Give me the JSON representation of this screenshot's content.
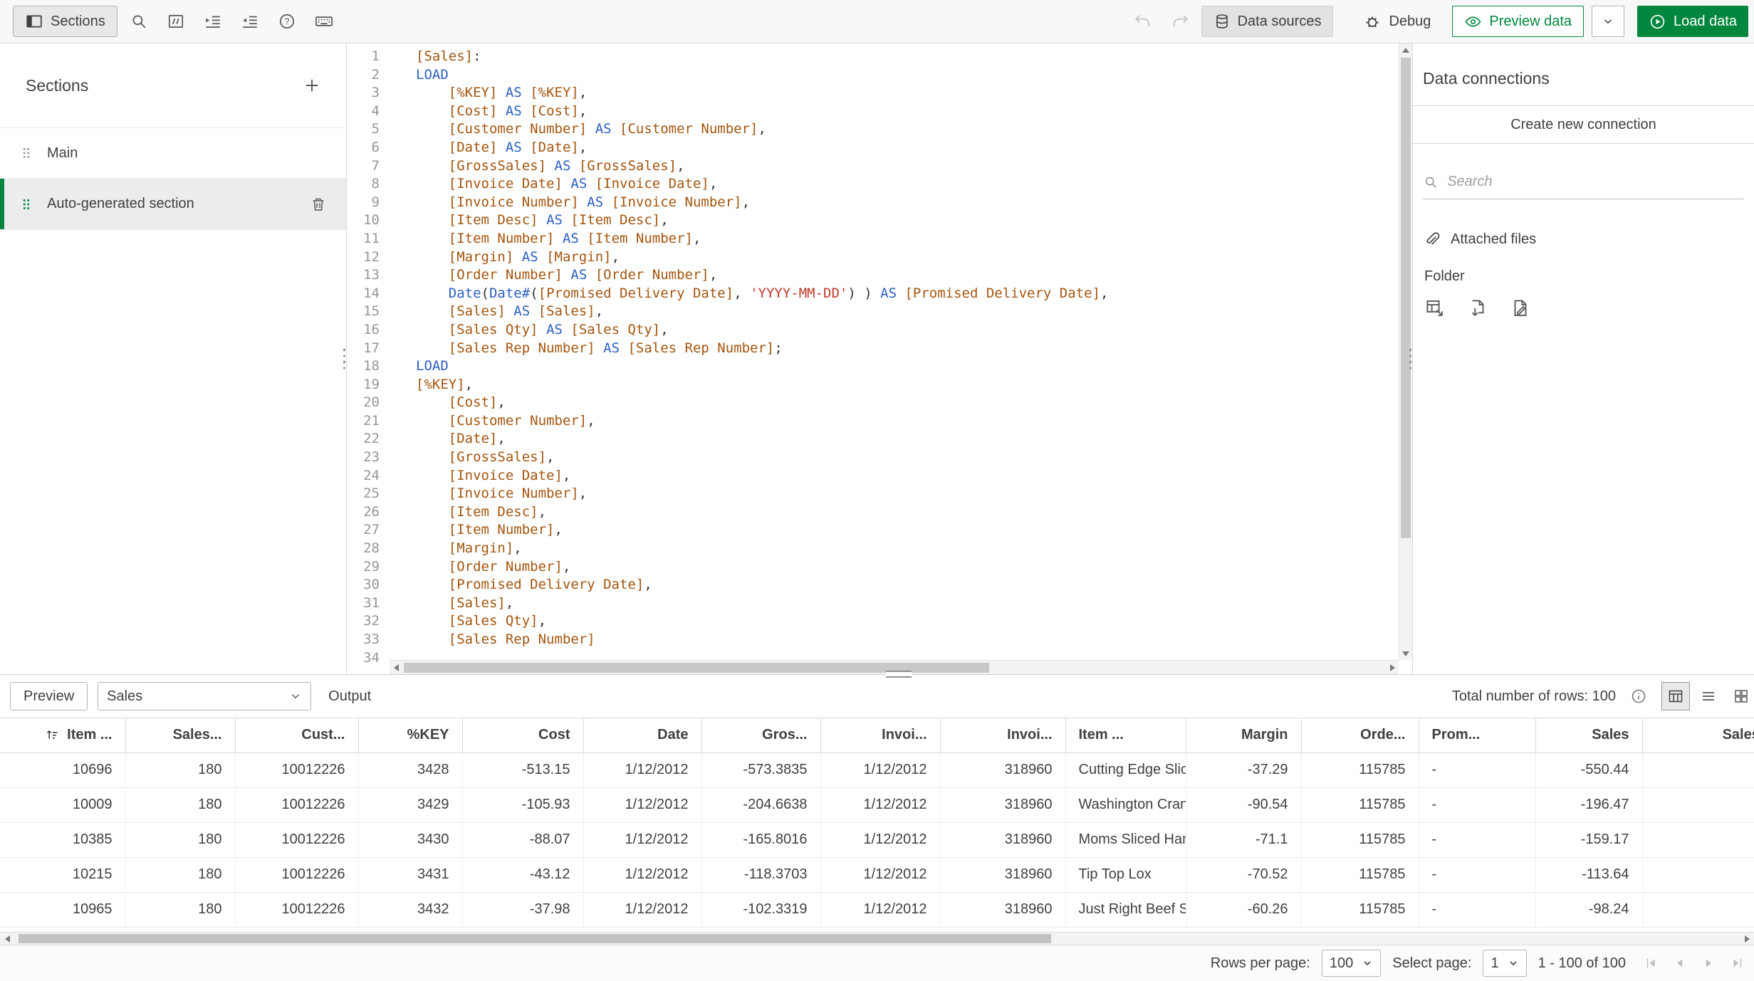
{
  "colors": {
    "accent_green": "#00873d",
    "toolbar_bg": "#f8f8f8",
    "selected_section_bg": "#ececec"
  },
  "icons": {
    "panel-toggle-icon": "sidebar-panel",
    "search-icon": "magnifier",
    "comment-icon": "box-with-double-slash",
    "indent-icon": "indent-arrow-lines",
    "outdent-icon": "outdent-arrow-lines",
    "help-icon": "question-circle",
    "keyboard-icon": "keyboard",
    "undo-icon": "curved-arrow-left",
    "redo-icon": "curved-arrow-right",
    "data-sources-icon": "database-cylinder",
    "debug-icon": "bug",
    "preview-data-icon": "eye",
    "load-data-icon": "play-circle",
    "add-icon": "plus",
    "drag-handle-icon": "grip-dots",
    "delete-icon": "trash-can",
    "attach-icon": "paperclip",
    "info-icon": "info-circle",
    "table-view-icon": "table-grid",
    "list-view-icon": "hamburger-rows",
    "card-view-icon": "card-grid",
    "sort-asc-icon": "arrow-up-with-bars",
    "chevron-down-icon": "chevron-down",
    "first-page-icon": "bar-triangle-left",
    "prev-page-icon": "triangle-left",
    "next-page-icon": "triangle-right",
    "last-page-icon": "triangle-bar-right"
  },
  "toolbar": {
    "sections_label": "Sections",
    "data_sources_label": "Data sources",
    "debug_label": "Debug",
    "preview_data_label": "Preview data",
    "load_data_label": "Load data"
  },
  "sections_panel": {
    "title": "Sections",
    "items": [
      {
        "label": "Main",
        "selected": false
      },
      {
        "label": "Auto-generated section",
        "selected": true
      }
    ]
  },
  "editor": {
    "lines": [
      "[Sales]:",
      "LOAD",
      "    [%KEY] AS [%KEY],",
      "    [Cost] AS [Cost],",
      "    [Customer Number] AS [Customer Number],",
      "    [Date] AS [Date],",
      "    [GrossSales] AS [GrossSales],",
      "    [Invoice Date] AS [Invoice Date],",
      "    [Invoice Number] AS [Invoice Number],",
      "    [Item Desc] AS [Item Desc],",
      "    [Item Number] AS [Item Number],",
      "    [Margin] AS [Margin],",
      "    [Order Number] AS [Order Number],",
      "    Date(Date#([Promised Delivery Date], 'YYYY-MM-DD') ) AS [Promised Delivery Date],",
      "    [Sales] AS [Sales],",
      "    [Sales Qty] AS [Sales Qty],",
      "    [Sales Rep Number] AS [Sales Rep Number];",
      "LOAD",
      "[%KEY],",
      "    [Cost],",
      "    [Customer Number],",
      "    [Date],",
      "    [GrossSales],",
      "    [Invoice Date],",
      "    [Invoice Number],",
      "    [Item Desc],",
      "    [Item Number],",
      "    [Margin],",
      "    [Order Number],",
      "    [Promised Delivery Date],",
      "    [Sales],",
      "    [Sales Qty],",
      "    [Sales Rep Number]",
      ""
    ]
  },
  "data_connections": {
    "title": "Data connections",
    "create_button": "Create new connection",
    "search_placeholder": "Search",
    "attached_files_label": "Attached files",
    "folder_label": "Folder"
  },
  "preview_bar": {
    "preview_label": "Preview",
    "table_selector_value": "Sales",
    "output_label": "Output",
    "total_rows_label": "Total number of rows: 100"
  },
  "table": {
    "columns": [
      {
        "label": "Item ...",
        "align": "right",
        "sorted": true
      },
      {
        "label": "Sales...",
        "align": "right"
      },
      {
        "label": "Cust...",
        "align": "right"
      },
      {
        "label": "%KEY",
        "align": "right"
      },
      {
        "label": "Cost",
        "align": "right"
      },
      {
        "label": "Date",
        "align": "right"
      },
      {
        "label": "Gros...",
        "align": "right"
      },
      {
        "label": "Invoi...",
        "align": "right"
      },
      {
        "label": "Invoi...",
        "align": "right"
      },
      {
        "label": "Item ...",
        "align": "left"
      },
      {
        "label": "Margin",
        "align": "right"
      },
      {
        "label": "Orde...",
        "align": "right"
      },
      {
        "label": "Prom...",
        "align": "left"
      },
      {
        "label": "Sales",
        "align": "right"
      },
      {
        "label": "Sales...",
        "align": "right"
      }
    ],
    "rows": [
      [
        "10696",
        "180",
        "10012226",
        "3428",
        "-513.15",
        "1/12/2012",
        "-573.3835",
        "1/12/2012",
        "318960",
        "Cutting Edge Slic",
        "-37.29",
        "115785",
        "-",
        "-550.44",
        ""
      ],
      [
        "10009",
        "180",
        "10012226",
        "3429",
        "-105.93",
        "1/12/2012",
        "-204.6638",
        "1/12/2012",
        "318960",
        "Washington Cran",
        "-90.54",
        "115785",
        "-",
        "-196.47",
        ""
      ],
      [
        "10385",
        "180",
        "10012226",
        "3430",
        "-88.07",
        "1/12/2012",
        "-165.8016",
        "1/12/2012",
        "318960",
        "Moms Sliced Ham",
        "-71.1",
        "115785",
        "-",
        "-159.17",
        ""
      ],
      [
        "10215",
        "180",
        "10012226",
        "3431",
        "-43.12",
        "1/12/2012",
        "-118.3703",
        "1/12/2012",
        "318960",
        "Tip Top Lox",
        "-70.52",
        "115785",
        "-",
        "-113.64",
        ""
      ],
      [
        "10965",
        "180",
        "10012226",
        "3432",
        "-37.98",
        "1/12/2012",
        "-102.3319",
        "1/12/2012",
        "318960",
        "Just Right Beef S",
        "-60.26",
        "115785",
        "-",
        "-98.24",
        ""
      ]
    ]
  },
  "footer": {
    "rows_per_page_label": "Rows per page:",
    "rows_per_page_value": "100",
    "select_page_label": "Select page:",
    "select_page_value": "1",
    "range_label": "1 - 100 of 100"
  }
}
